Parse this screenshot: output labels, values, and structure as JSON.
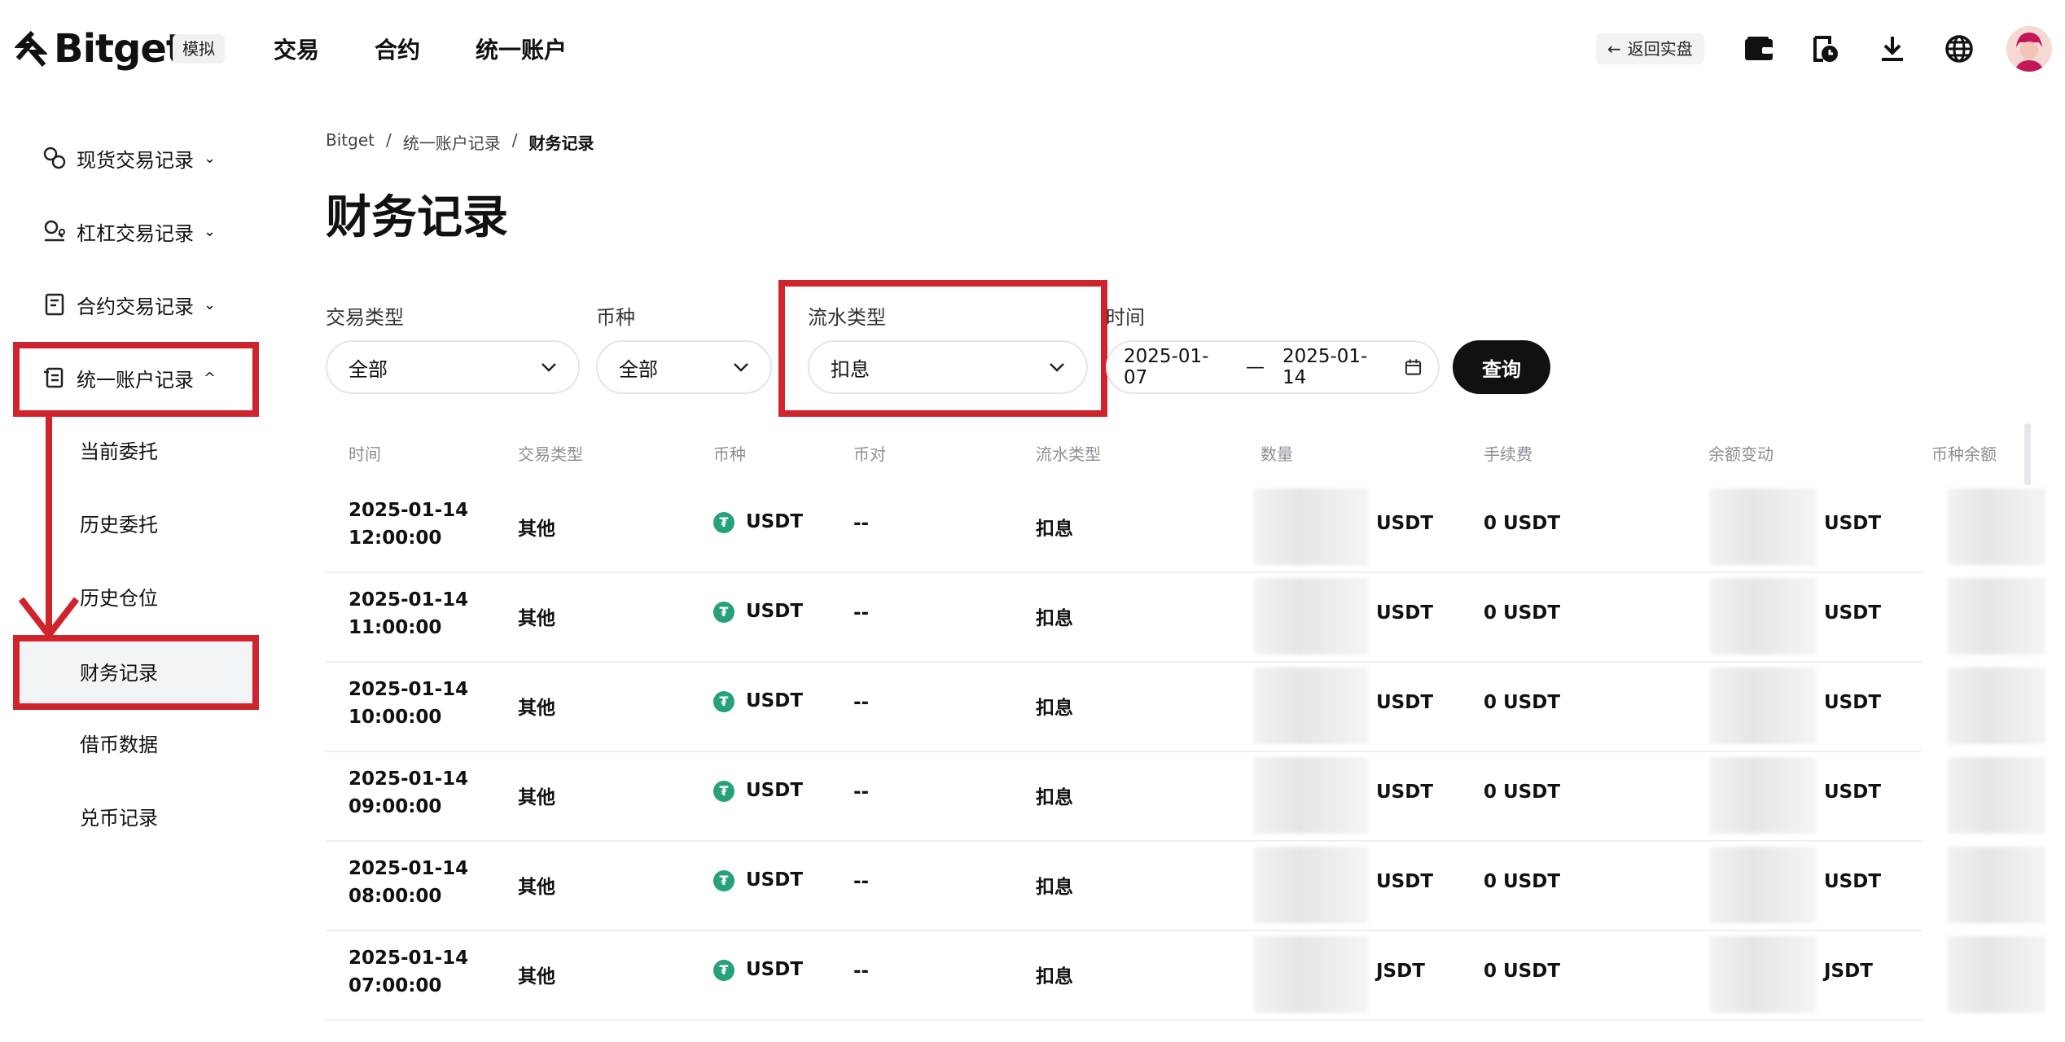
{
  "header": {
    "brand": "Bitget",
    "demo_badge": "模拟",
    "nav": [
      "交易",
      "合约",
      "统一账户"
    ],
    "back_label": "返回实盘",
    "icons": [
      "wallet-icon",
      "history-icon",
      "download-icon",
      "globe-icon"
    ]
  },
  "sidebar": {
    "items": [
      {
        "label": "现货交易记录",
        "icon": "spot-icon",
        "chevron": "down"
      },
      {
        "label": "杠杠交易记录",
        "icon": "margin-icon",
        "chevron": "down"
      },
      {
        "label": "合约交易记录",
        "icon": "contract-icon",
        "chevron": "down"
      },
      {
        "label": "统一账户记录",
        "icon": "ledger-icon",
        "chevron": "up"
      }
    ],
    "sub_items": [
      "当前委托",
      "历史委托",
      "历史仓位",
      "财务记录",
      "借币数据",
      "兑币记录"
    ],
    "active": "财务记录"
  },
  "breadcrumb": [
    "Bitget",
    "统一账户记录",
    "财务记录"
  ],
  "page_title": "财务记录",
  "filters": {
    "trade_type": {
      "label": "交易类型",
      "value": "全部"
    },
    "coin": {
      "label": "币种",
      "value": "全部"
    },
    "flow_type": {
      "label": "流水类型",
      "value": "扣息"
    },
    "time": {
      "label": "时间",
      "start": "2025-01-07",
      "end": "2025-01-14",
      "separator": "—"
    },
    "query_label": "查询"
  },
  "table": {
    "columns": [
      "时间",
      "交易类型",
      "币种",
      "币对",
      "流水类型",
      "数量",
      "手续费",
      "余额变动",
      "币种余额"
    ],
    "rows": [
      {
        "date": "2025-01-14",
        "time": "12:00:00",
        "type": "其他",
        "coin": "USDT",
        "pair": "--",
        "flow": "扣息",
        "amount_unit": "USDT",
        "fee": "0 USDT",
        "change_unit": "USDT"
      },
      {
        "date": "2025-01-14",
        "time": "11:00:00",
        "type": "其他",
        "coin": "USDT",
        "pair": "--",
        "flow": "扣息",
        "amount_unit": "USDT",
        "fee": "0 USDT",
        "change_unit": "USDT"
      },
      {
        "date": "2025-01-14",
        "time": "10:00:00",
        "type": "其他",
        "coin": "USDT",
        "pair": "--",
        "flow": "扣息",
        "amount_unit": "USDT",
        "fee": "0 USDT",
        "change_unit": "USDT"
      },
      {
        "date": "2025-01-14",
        "time": "09:00:00",
        "type": "其他",
        "coin": "USDT",
        "pair": "--",
        "flow": "扣息",
        "amount_unit": "USDT",
        "fee": "0 USDT",
        "change_unit": "USDT"
      },
      {
        "date": "2025-01-14",
        "time": "08:00:00",
        "type": "其他",
        "coin": "USDT",
        "pair": "--",
        "flow": "扣息",
        "amount_unit": "USDT",
        "fee": "0 USDT",
        "change_unit": "USDT"
      },
      {
        "date": "2025-01-14",
        "time": "07:00:00",
        "type": "其他",
        "coin": "USDT",
        "pair": "--",
        "flow": "扣息",
        "amount_unit": "JSDT",
        "fee": "0 USDT",
        "change_unit": "JSDT"
      }
    ]
  },
  "colors": {
    "accent_red": "#d0242c",
    "button_dark": "#111111",
    "tether_green": "#26a17b"
  }
}
